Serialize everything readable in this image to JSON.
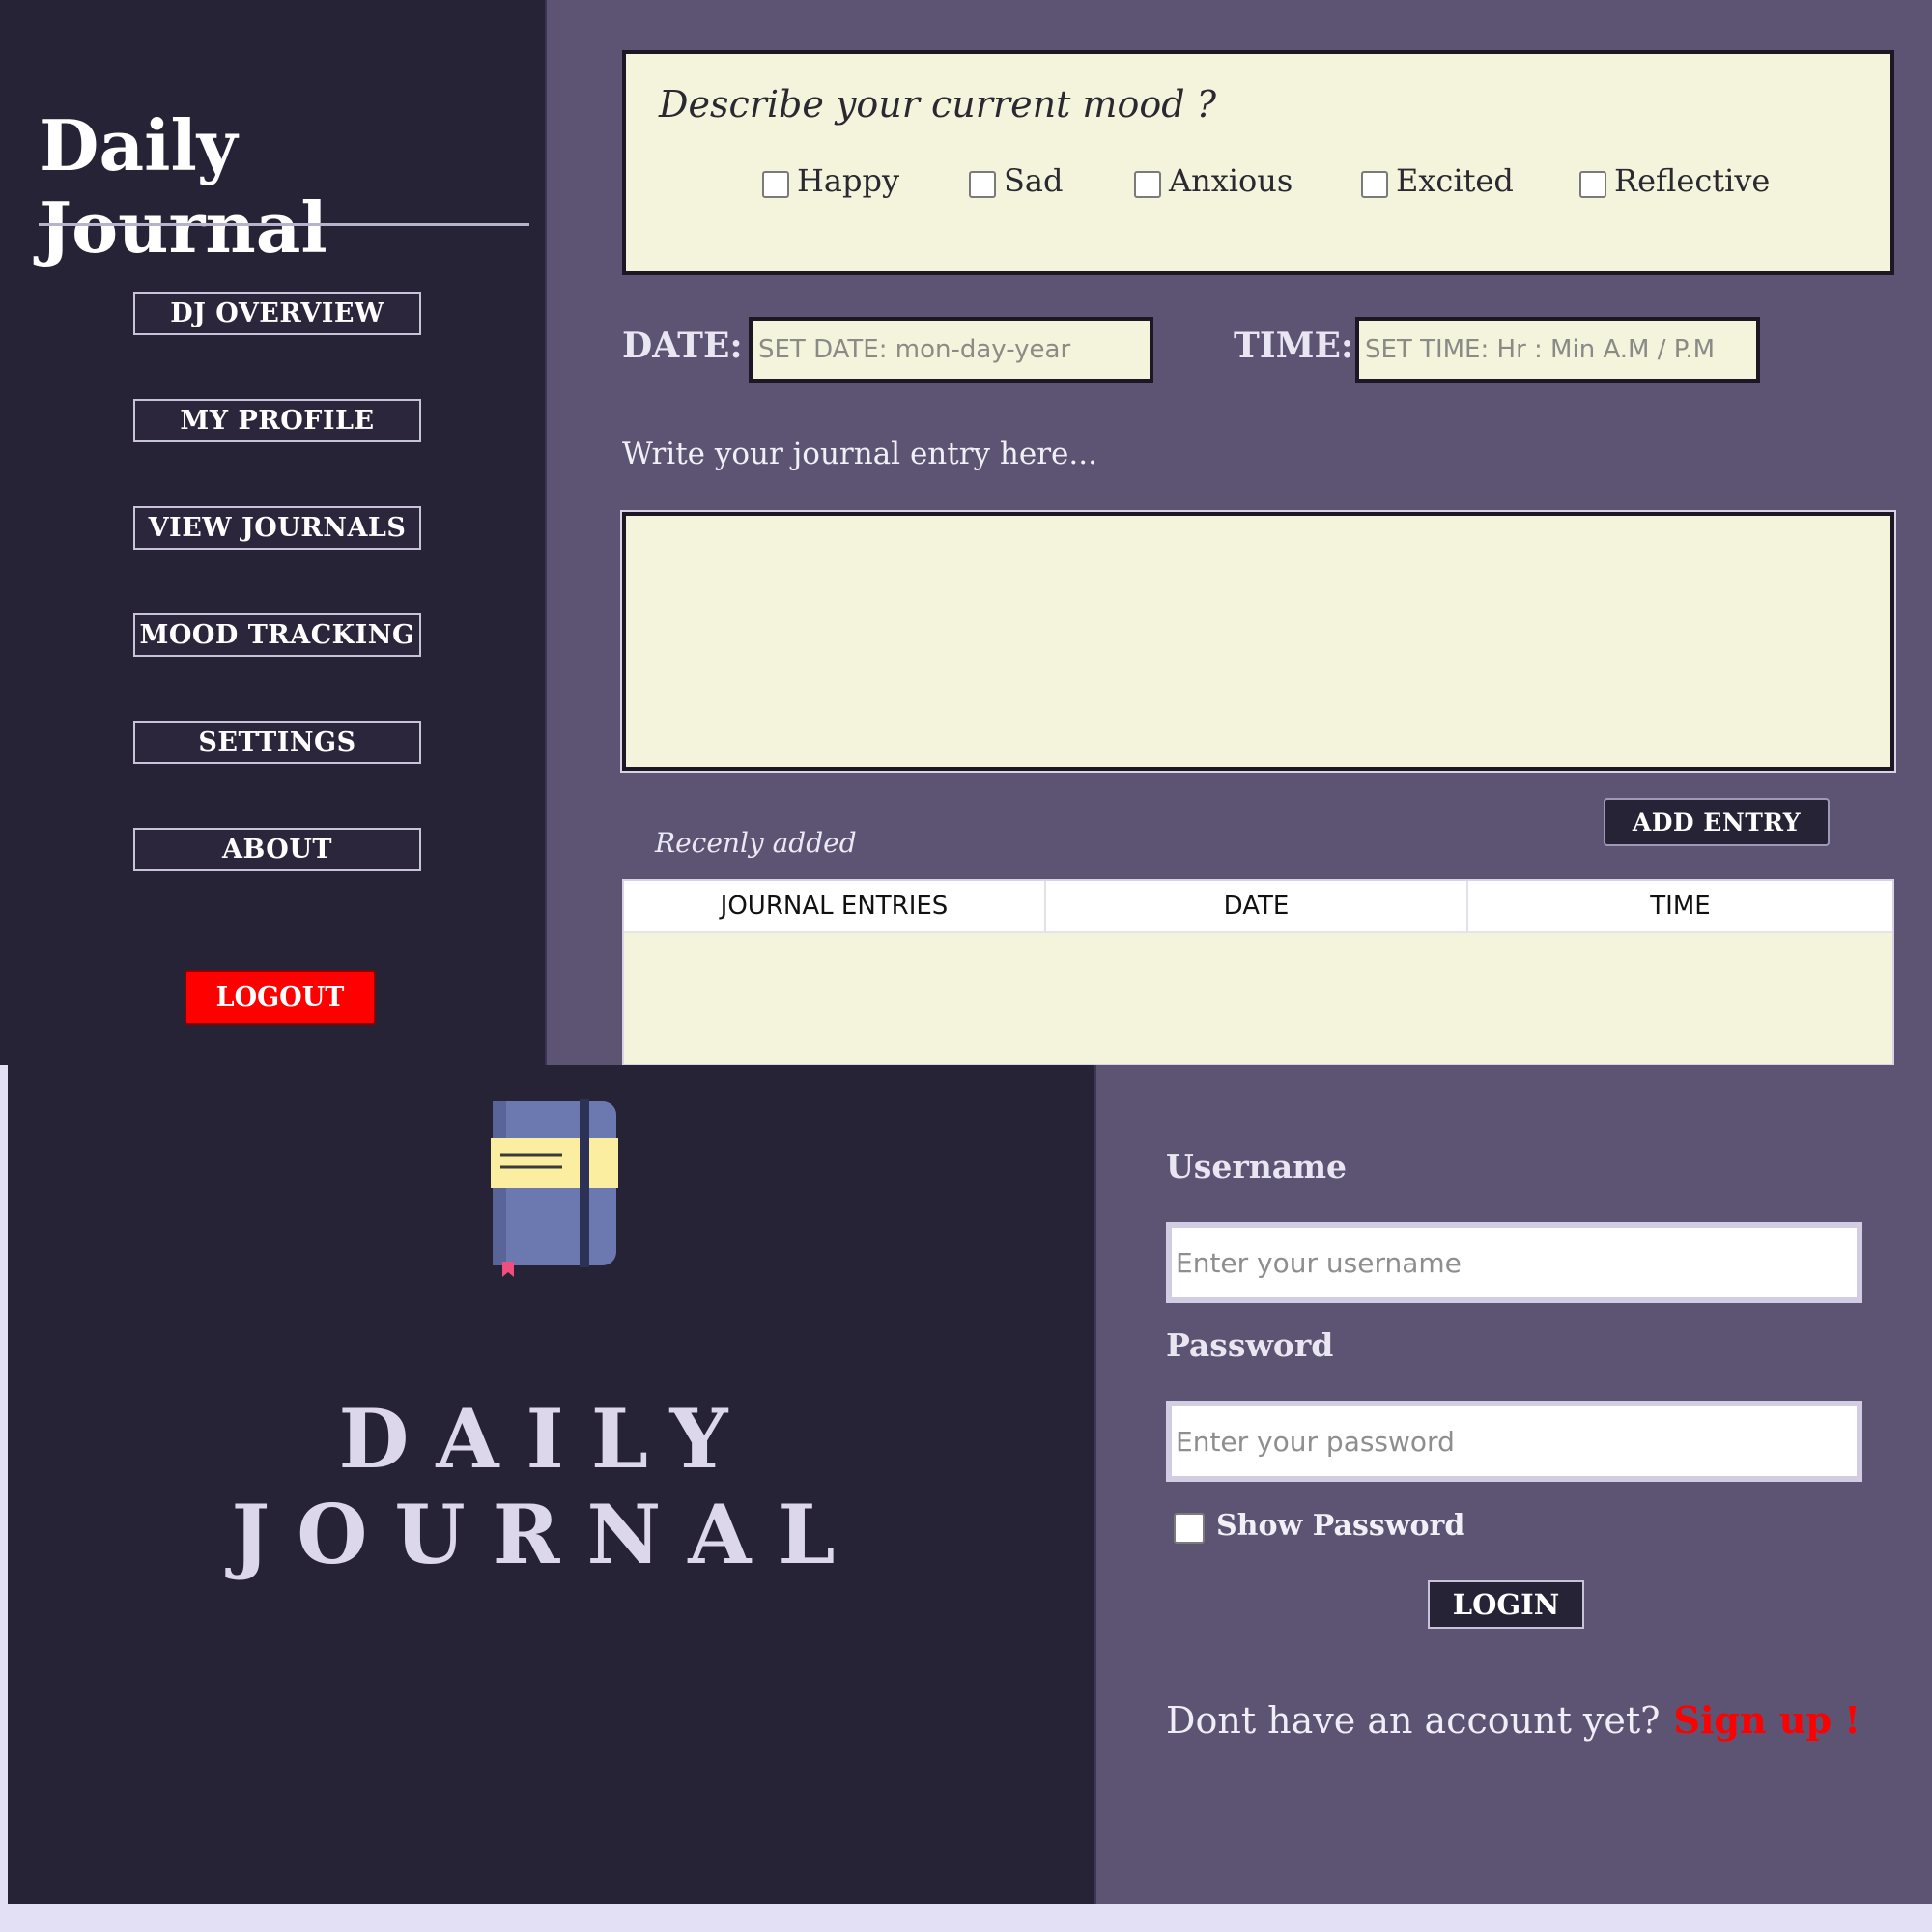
{
  "dashboard": {
    "title": "Daily Journal",
    "nav": [
      "DJ OVERVIEW",
      "MY PROFILE",
      "VIEW JOURNALS",
      "MOOD TRACKING",
      "SETTINGS",
      "ABOUT"
    ],
    "logout_label": "LOGOUT",
    "mood": {
      "question": "Describe your current mood ?",
      "options": [
        "Happy",
        "Sad",
        "Anxious",
        "Excited",
        "Reflective"
      ]
    },
    "date": {
      "label": "DATE:",
      "placeholder": "SET DATE: mon-day-year"
    },
    "time": {
      "label": "TIME:",
      "placeholder": "SET TIME: Hr : Min A.M / P.M"
    },
    "entry_hint": "Write your journal entry here...",
    "add_entry_label": "ADD ENTRY",
    "recent_label": "Recenly added",
    "table_headers": [
      "JOURNAL ENTRIES",
      "DATE",
      "TIME"
    ]
  },
  "login": {
    "brand": "DAILY JOURNAL",
    "username_label": "Username",
    "username_placeholder": "Enter your username",
    "password_label": "Password",
    "password_placeholder": "Enter your password",
    "show_password_label": "Show Password",
    "login_label": "LOGIN",
    "signup_prompt": "Dont have an account yet?",
    "signup_link": "Sign up !"
  },
  "colors": {
    "sidebar_bg": "#272336",
    "main_bg": "#5c5472",
    "panel_cream": "#f4f3dc",
    "danger_red": "#ff0000"
  },
  "icons": {
    "logo": "journal-notebook-icon"
  }
}
